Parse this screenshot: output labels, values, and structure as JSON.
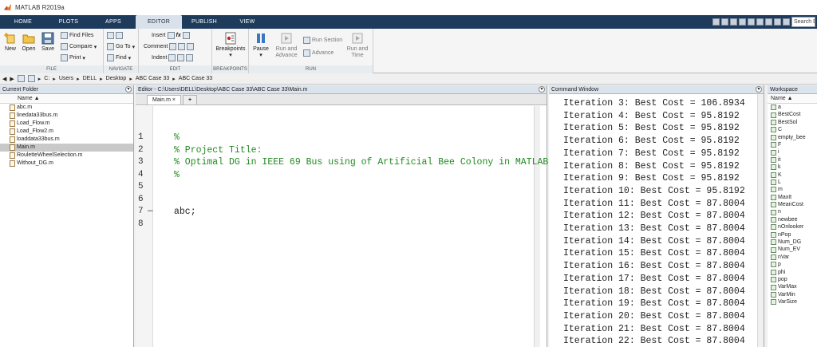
{
  "window": {
    "title": "MATLAB R2019a"
  },
  "tabs": [
    {
      "label": "HOME"
    },
    {
      "label": "PLOTS"
    },
    {
      "label": "APPS"
    },
    {
      "label": "EDITOR"
    },
    {
      "label": "PUBLISH"
    },
    {
      "label": "VIEW"
    }
  ],
  "search": {
    "placeholder": "Search D"
  },
  "ribbon": {
    "file": {
      "label": "FILE",
      "new": "New",
      "open": "Open",
      "save": "Save",
      "find_files": "Find Files",
      "compare": "Compare",
      "print": "Print"
    },
    "navigate": {
      "label": "NAVIGATE",
      "goto": "Go To",
      "find": "Find"
    },
    "edit": {
      "label": "EDIT",
      "insert": "Insert",
      "comment": "Comment",
      "indent": "Indent"
    },
    "breakpoints": {
      "label": "BREAKPOINTS",
      "btn": "Breakpoints"
    },
    "run": {
      "label": "RUN",
      "pause": "Pause",
      "run_advance": "Run and Advance",
      "run_section": "Run Section",
      "advance": "Advance",
      "run_time": "Run and Time"
    }
  },
  "address": {
    "parts": [
      "C:",
      "Users",
      "DELL",
      "Desktop",
      "ABC Case 33",
      "ABC Case 33"
    ]
  },
  "current_folder": {
    "title": "Current Folder",
    "column": "Name",
    "files": [
      "abc.m",
      "linedata33bus.m",
      "Load_Flow.m",
      "Load_Flow2.m",
      "loaddata33bus.m",
      "Main.m",
      "RouletteWheelSelection.m",
      "Without_DG.m"
    ],
    "selected": "Main.m"
  },
  "editor": {
    "title": "Editor - C:\\Users\\DELL\\Desktop\\ABC Case 33\\ABC Case 33\\Main.m",
    "tab": "Main.m",
    "lines": [
      {
        "n": "1",
        "text": "%",
        "cls": "cm"
      },
      {
        "n": "2",
        "text": "% Project Title:",
        "cls": "cm"
      },
      {
        "n": "3",
        "text": "% Optimal DG in IEEE 69 Bus using of Artificial Bee Colony in MATLAB",
        "cls": "cm"
      },
      {
        "n": "4",
        "text": "%",
        "cls": "cm"
      },
      {
        "n": "5",
        "text": "",
        "cls": ""
      },
      {
        "n": "6",
        "text": "",
        "cls": ""
      },
      {
        "n": "7",
        "text": "abc;",
        "cls": ""
      },
      {
        "n": "8",
        "text": "",
        "cls": ""
      }
    ]
  },
  "command_window": {
    "title": "Command Window",
    "lines": [
      "Iteration 3: Best Cost = 106.8934",
      "Iteration 4: Best Cost = 95.8192",
      "Iteration 5: Best Cost = 95.8192",
      "Iteration 6: Best Cost = 95.8192",
      "Iteration 7: Best Cost = 95.8192",
      "Iteration 8: Best Cost = 95.8192",
      "Iteration 9: Best Cost = 95.8192",
      "Iteration 10: Best Cost = 95.8192",
      "Iteration 11: Best Cost = 87.8004",
      "Iteration 12: Best Cost = 87.8004",
      "Iteration 13: Best Cost = 87.8004",
      "Iteration 14: Best Cost = 87.8004",
      "Iteration 15: Best Cost = 87.8004",
      "Iteration 16: Best Cost = 87.8004",
      "Iteration 17: Best Cost = 87.8004",
      "Iteration 18: Best Cost = 87.8004",
      "Iteration 19: Best Cost = 87.8004",
      "Iteration 20: Best Cost = 87.8004",
      "Iteration 21: Best Cost = 87.8004",
      "Iteration 22: Best Cost = 87.8004"
    ]
  },
  "workspace": {
    "title": "Workspace",
    "column": "Name",
    "vars": [
      "a",
      "BestCost",
      "BestSol",
      "C",
      "empty_bee",
      "F",
      "i",
      "it",
      "k",
      "K",
      "L",
      "m",
      "MaxIt",
      "MeanCost",
      "n",
      "newbee",
      "nOnlooker",
      "nPop",
      "Num_DG",
      "Num_EV",
      "nVar",
      "p",
      "phi",
      "pop",
      "VarMax",
      "VarMin",
      "VarSize"
    ]
  }
}
